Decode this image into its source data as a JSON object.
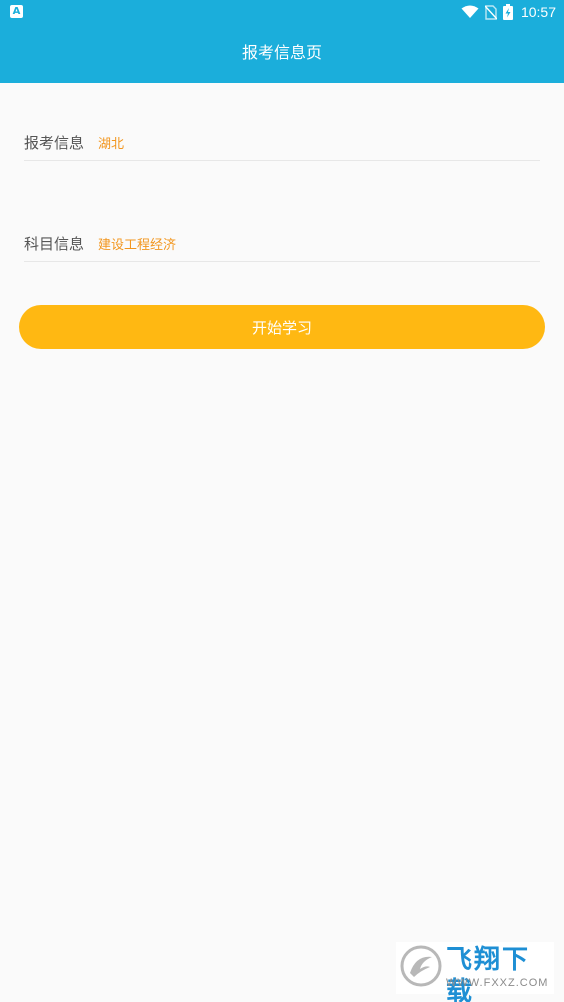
{
  "status_bar": {
    "notification_icon": "a-icon",
    "notification_glyph": "A",
    "time": "10:57",
    "icons": [
      "wifi-icon",
      "no-sim-icon",
      "battery-charging-icon"
    ]
  },
  "app_bar": {
    "title": "报考信息页",
    "background_color": "#1baedb"
  },
  "form": {
    "exam_info": {
      "label": "报考信息",
      "value": "湖北"
    },
    "subject_info": {
      "label": "科目信息",
      "value": "建设工程经济"
    },
    "value_color": "#f2961e"
  },
  "start_button": {
    "label": "开始学习",
    "color": "#ffb812"
  },
  "watermark": {
    "title": "飞翔下载",
    "url": "WWW.FXXZ.COM"
  }
}
